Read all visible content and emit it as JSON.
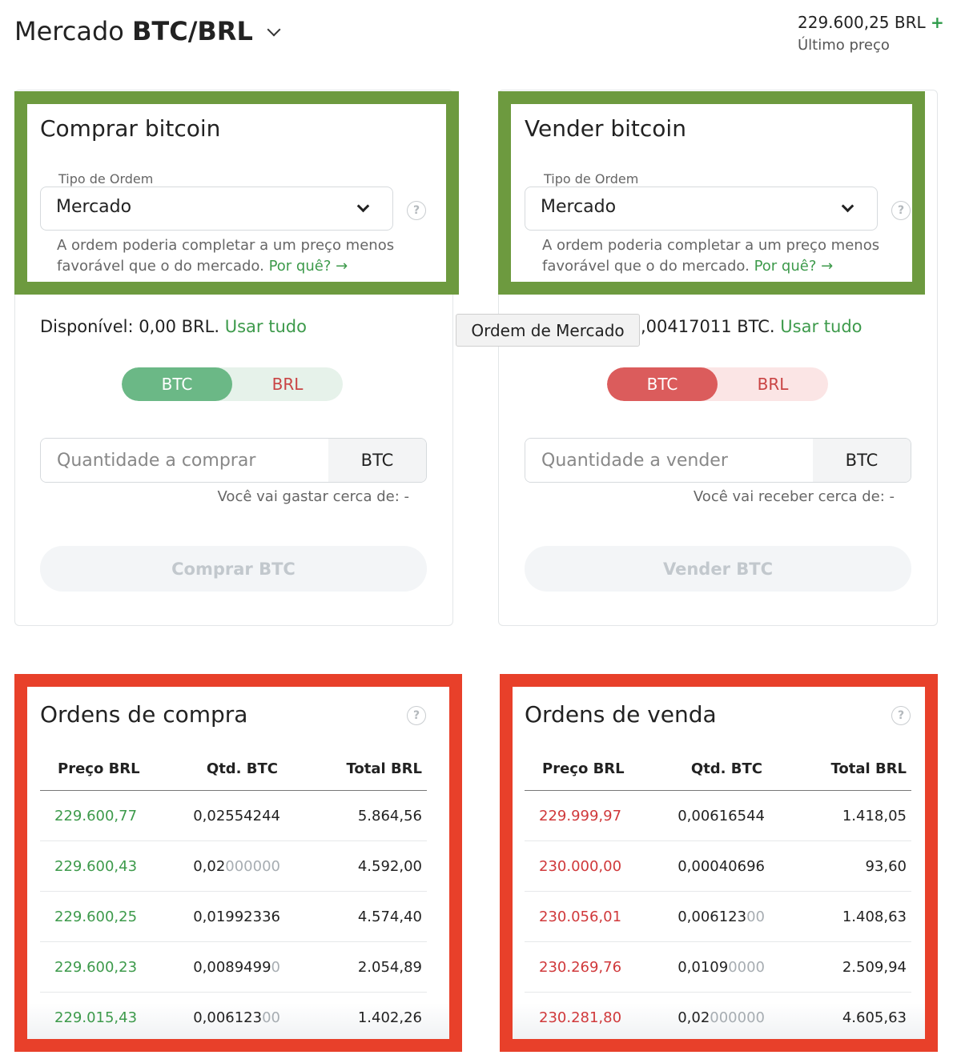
{
  "header": {
    "market_prefix": "Mercado",
    "market_pair": "BTC/BRL",
    "last_price": "229.600,25 BRL",
    "last_price_change_sign": "+",
    "last_price_label": "Último preço"
  },
  "buy_panel": {
    "title": "Comprar bitcoin",
    "order_type_label": "Tipo de Ordem",
    "order_type_value": "Mercado",
    "note": "A ordem poderia completar a um preço menos favorável que o do mercado.",
    "note_link": "Por quê? →",
    "available_label": "Disponível:",
    "available_value": "0,00 BRL.",
    "use_all": "Usar tudo",
    "toggle_on": "BTC",
    "toggle_off": "BRL",
    "amount_placeholder": "Quantidade a comprar",
    "amount_unit": "BTC",
    "estimate": "Você vai gastar cerca de: -",
    "action": "Comprar BTC"
  },
  "sell_panel": {
    "title": "Vender bitcoin",
    "order_type_label": "Tipo de Ordem",
    "order_type_value": "Mercado",
    "note": "A ordem poderia completar a um preço menos favorável que o do mercado.",
    "note_link": "Por quê? →",
    "available_partial": ",00417011 BTC.",
    "use_all": "Usar tudo",
    "toggle_on": "BTC",
    "toggle_off": "BRL",
    "amount_placeholder": "Quantidade a vender",
    "amount_unit": "BTC",
    "estimate": "Você vai receber cerca de: -",
    "action": "Vender BTC"
  },
  "tooltip": "Ordem de Mercado",
  "help_glyph": "?",
  "buy_orders": {
    "title": "Ordens de compra",
    "columns": [
      "Preço BRL",
      "Qtd. BTC",
      "Total BRL"
    ],
    "rows": [
      {
        "price": "229.600,77",
        "qty": "0,02554244",
        "qty_muted": "",
        "total": "5.864,56"
      },
      {
        "price": "229.600,43",
        "qty": "0,02",
        "qty_muted": "000000",
        "total": "4.592,00"
      },
      {
        "price": "229.600,25",
        "qty": "0,01992336",
        "qty_muted": "",
        "total": "4.574,40"
      },
      {
        "price": "229.600,23",
        "qty": "0,0089499",
        "qty_muted": "0",
        "total": "2.054,89"
      },
      {
        "price": "229.015,43",
        "qty": "0,006123",
        "qty_muted": "00",
        "total": "1.402,26"
      }
    ]
  },
  "sell_orders": {
    "title": "Ordens de venda",
    "columns": [
      "Preço BRL",
      "Qtd. BTC",
      "Total BRL"
    ],
    "rows": [
      {
        "price": "229.999,97",
        "qty": "0,00616544",
        "qty_muted": "",
        "total": "1.418,05"
      },
      {
        "price": "230.000,00",
        "qty": "0,00040696",
        "qty_muted": "",
        "total": "93,60"
      },
      {
        "price": "230.056,01",
        "qty": "0,006123",
        "qty_muted": "00",
        "total": "1.408,63"
      },
      {
        "price": "230.269,76",
        "qty": "0,0109",
        "qty_muted": "0000",
        "total": "2.509,94"
      },
      {
        "price": "230.281,80",
        "qty": "0,02",
        "qty_muted": "000000",
        "total": "4.605,63"
      }
    ]
  }
}
